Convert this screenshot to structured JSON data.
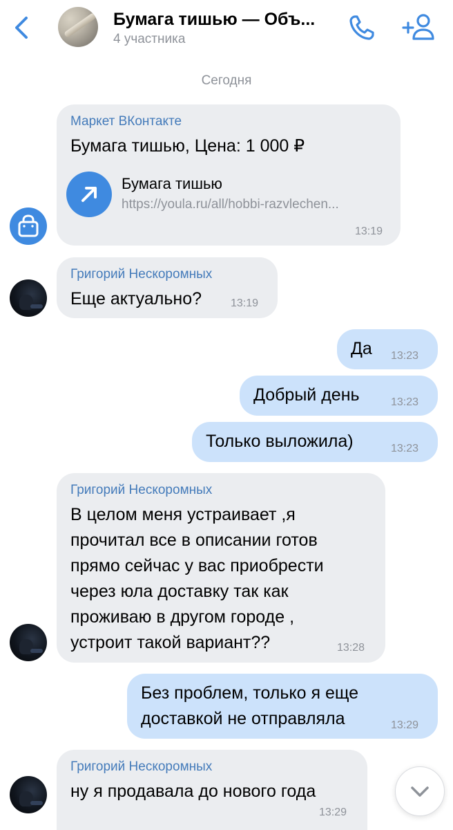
{
  "header": {
    "title": "Бумага тишью — Объ...",
    "subtitle": "4 участника"
  },
  "date_separator": "Сегодня",
  "messages": [
    {
      "sender": "Маркет ВКонтакте",
      "text": "Бумага тишью, Цена: 1 000 ₽",
      "link_title": "Бумага тишью",
      "link_url": "https://youla.ru/all/hobbi-razvlechen...",
      "time": "13:19"
    },
    {
      "sender": "Григорий Нескоромных",
      "text": "Еще актуально?",
      "time": "13:19"
    },
    {
      "text": "Да",
      "time": "13:23"
    },
    {
      "text": "Добрый день",
      "time": "13:23"
    },
    {
      "text": "Только выложила)",
      "time": "13:23"
    },
    {
      "sender": "Григорий Нескоромных",
      "lines": [
        "В целом меня устраивает ,я",
        "прочитал все в описании готов",
        "прямо сейчас у вас приобрести",
        "через юла доставку так как",
        "проживаю в другом городе ,",
        "устроит такой вариант??"
      ],
      "time": "13:28"
    },
    {
      "lines": [
        "Без проблем, только я еще",
        "доставкой не отправляла"
      ],
      "time": "13:29"
    },
    {
      "sender": "Григорий Нескоромных",
      "text": "ну я продавала до нового года",
      "time": "13:29"
    }
  ],
  "icons": {
    "back": "chevron-left-icon",
    "call": "phone-icon",
    "add_member": "add-user-icon",
    "market": "shopping-bag-icon",
    "link": "arrow-up-right-icon",
    "scroll": "chevron-down-icon"
  },
  "colors": {
    "accent": "#3f8ae0",
    "incoming_bubble": "#ebedf0",
    "outgoing_bubble": "#cce2fb",
    "sender_name": "#447bba",
    "secondary_text": "#8e9299"
  }
}
